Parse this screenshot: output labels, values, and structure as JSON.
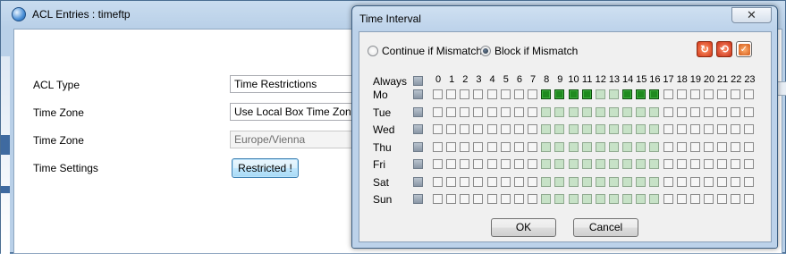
{
  "background_window": {
    "title": "ACL Entries : timeftp",
    "form": [
      {
        "label": "ACL Type",
        "value": "Time Restrictions"
      },
      {
        "label": "Time Zone",
        "value": "Use Local Box Time Zone"
      },
      {
        "label": "Time Zone",
        "value": "Europe/Vienna"
      },
      {
        "label": "Time Settings"
      }
    ],
    "restricted_button_label": "Restricted !"
  },
  "dialog": {
    "title": "Time Interval",
    "close_glyph": "✕",
    "radios": [
      {
        "label": "Continue if Mismatch",
        "checked": false
      },
      {
        "label": "Block if Mismatch",
        "checked": true
      }
    ],
    "toolbar_icons": [
      "refresh-icon",
      "reset-icon",
      "apply-icon"
    ],
    "always_label": "Always",
    "hours": [
      "0",
      "1",
      "2",
      "3",
      "4",
      "5",
      "6",
      "7",
      "8",
      "9",
      "10",
      "11",
      "12",
      "13",
      "14",
      "15",
      "16",
      "17",
      "18",
      "19",
      "20",
      "21",
      "22",
      "23"
    ],
    "days": [
      "Mo",
      "Tue",
      "Wed",
      "Thu",
      "Fri",
      "Sat",
      "Sun"
    ],
    "working_hours": [
      8,
      9,
      10,
      11,
      12,
      13,
      14,
      15,
      16
    ],
    "selected": {
      "Mo": [
        8,
        9,
        10,
        11,
        14,
        15,
        16
      ]
    },
    "ok_label": "OK",
    "cancel_label": "Cancel",
    "colors": {
      "selected_cell": "#1f8a1f",
      "working_cell": "#c7e2c7",
      "empty_cell": "#f6f6f6"
    }
  }
}
